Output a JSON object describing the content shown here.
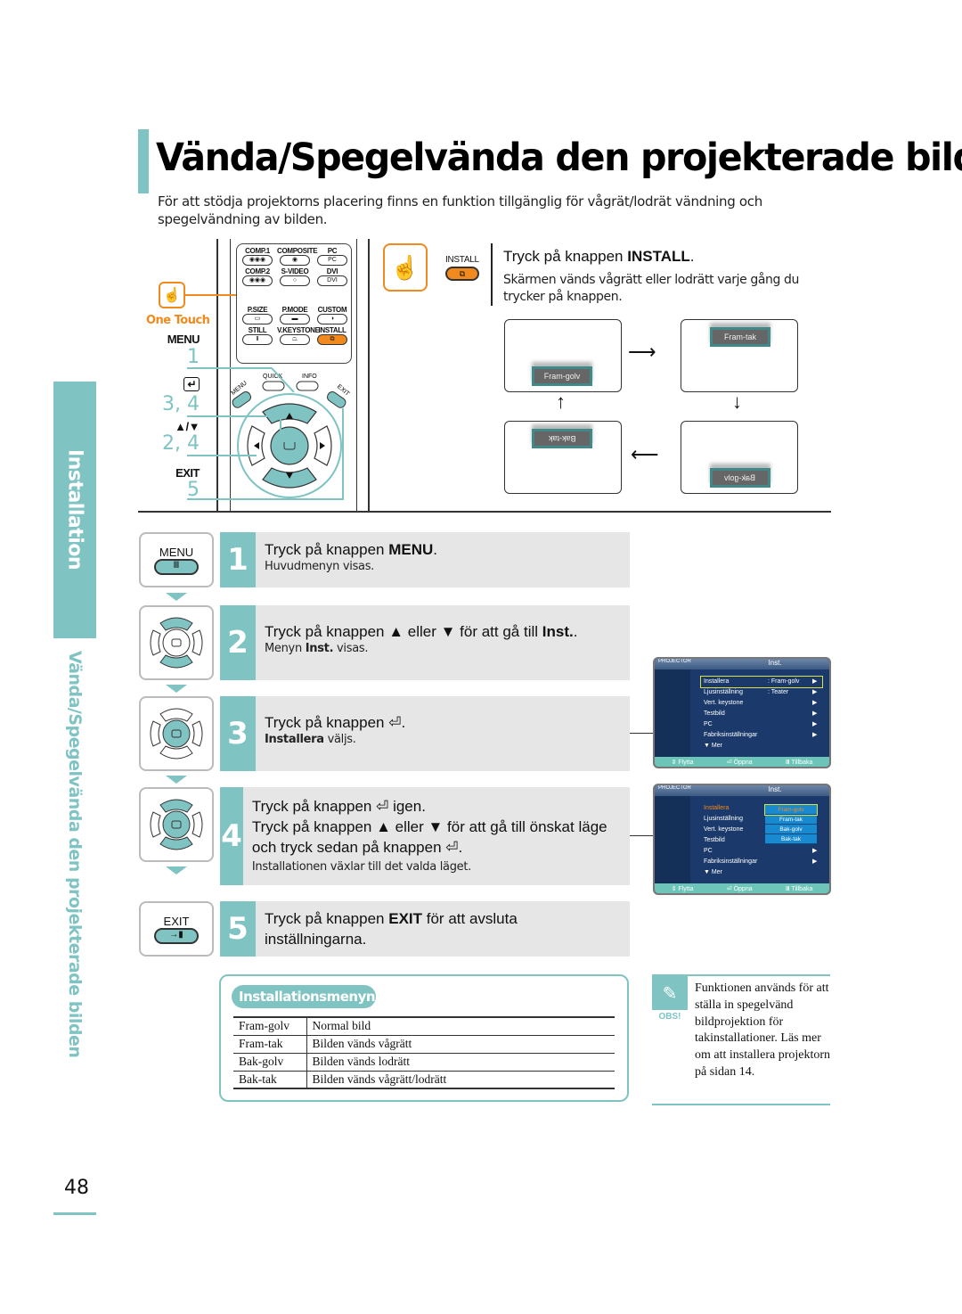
{
  "title": "Vända/Spegelvända den projekterade bilden",
  "intro": "För att stödja projektorns placering finns en funktion tillgänglig för vågrät/lodrät vändning och spegelvändning av bilden.",
  "side_tab": {
    "section": "Installation",
    "subtitle": "Vända/Spegelvända den projekterade bilden"
  },
  "remote": {
    "one_touch_label": "One Touch",
    "buttons": [
      {
        "label": "COMP.1",
        "glyph": "◉◉◉"
      },
      {
        "label": "COMPOSITE",
        "glyph": "◉"
      },
      {
        "label": "PC",
        "glyph": "PC"
      },
      {
        "label": "COMP.2",
        "glyph": "◉◉◉"
      },
      {
        "label": "S-VIDEO",
        "glyph": "○"
      },
      {
        "label": "DVI",
        "glyph": "DVI"
      },
      {
        "label": "P.SIZE",
        "glyph": "▭"
      },
      {
        "label": "P.MODE",
        "glyph": "▬"
      },
      {
        "label": "CUSTOM",
        "glyph": "◑"
      },
      {
        "label": "STILL",
        "glyph": "Ⅱ"
      },
      {
        "label": "V.KEYSTONE",
        "glyph": "⏢"
      },
      {
        "label": "INSTALL",
        "glyph": "⧉"
      }
    ],
    "nav_labels": {
      "menu": "MENU",
      "quick": "QUICK",
      "info": "INFO",
      "exit": "EXIT"
    },
    "legend": [
      {
        "key": "MENU",
        "steps": "1"
      },
      {
        "key": "↵",
        "steps": "3, 4"
      },
      {
        "key": "▲/▼",
        "steps": "2, 4"
      },
      {
        "key": "EXIT",
        "steps": "5"
      }
    ]
  },
  "install": {
    "button_label": "INSTALL",
    "heading_prefix": "Tryck på knappen ",
    "heading_bold": "INSTALL",
    "heading_suffix": ".",
    "description": "Skärmen vänds vågrätt eller lodrätt varje gång du trycker på knappen."
  },
  "flip_diagram": {
    "screens": [
      {
        "label": "Fram-golv"
      },
      {
        "label": "Fram-tak"
      },
      {
        "label": "Bak-golv"
      },
      {
        "label": "Bak-tak"
      }
    ],
    "arrows": {
      "right": "⟶",
      "down": "↓",
      "left": "⟵",
      "up": "↑"
    }
  },
  "steps": [
    {
      "num": "1",
      "button": "MENU",
      "main": [
        {
          "t": "Tryck på knappen "
        },
        {
          "t": "MENU",
          "b": true
        },
        {
          "t": "."
        }
      ],
      "sub": [
        {
          "t": "Huvudmenyn visas."
        }
      ]
    },
    {
      "num": "2",
      "main": [
        {
          "t": "Tryck på knappen ▲ eller ▼ för att gå till "
        },
        {
          "t": "Inst.",
          "b": true
        },
        {
          "t": "."
        }
      ],
      "sub": [
        {
          "t": "Menyn "
        },
        {
          "t": "Inst.",
          "b": true
        },
        {
          "t": " visas."
        }
      ]
    },
    {
      "num": "3",
      "main": [
        {
          "t": "Tryck på knappen ⏎."
        }
      ],
      "sub": [
        {
          "t": "Installera",
          "b": true
        },
        {
          "t": " väljs."
        }
      ]
    },
    {
      "num": "4",
      "main": [
        {
          "t": "Tryck på knappen ⏎ igen."
        }
      ],
      "main2": "Tryck på knappen ▲ eller ▼ för att gå till önskat läge och tryck sedan på knappen ⏎.",
      "sub": [
        {
          "t": "Installationen växlar till det valda läget."
        }
      ]
    },
    {
      "num": "5",
      "button": "EXIT",
      "main": [
        {
          "t": "Tryck på knappen "
        },
        {
          "t": "EXIT",
          "b": true
        },
        {
          "t": " för att avsluta inställningarna."
        }
      ]
    }
  ],
  "osd_menus": [
    {
      "brand": "PROJECTOR",
      "tab": "Inst.",
      "items": [
        {
          "label": "Installera",
          "value": ": Fram-golv",
          "arrow": "▶",
          "highlight": true
        },
        {
          "label": "Ljusinställning",
          "value": ": Teater",
          "arrow": "▶"
        },
        {
          "label": "Vert. keystone",
          "value": "",
          "arrow": "▶"
        },
        {
          "label": "Testbild",
          "value": "",
          "arrow": "▶"
        },
        {
          "label": "PC",
          "value": "",
          "arrow": "▶"
        },
        {
          "label": "Fabriksinställningar",
          "value": "",
          "arrow": "▶"
        },
        {
          "label": "▼ Mer",
          "value": "",
          "arrow": ""
        }
      ],
      "footer": [
        "⇕ Flytta",
        "⏎ Öppna",
        "Ⅲ Tillbaka"
      ]
    },
    {
      "brand": "PROJECTOR",
      "tab": "Inst.",
      "items": [
        {
          "label": "Installera",
          "value": ":",
          "arrow": "",
          "active": true
        },
        {
          "label": "Ljusinställning",
          "value": ":",
          "arrow": ""
        },
        {
          "label": "Vert. keystone",
          "value": "",
          "arrow": ""
        },
        {
          "label": "Testbild",
          "value": "",
          "arrow": ""
        },
        {
          "label": "PC",
          "value": "",
          "arrow": "▶"
        },
        {
          "label": "Fabriksinställningar",
          "value": "",
          "arrow": "▶"
        },
        {
          "label": "▼ Mer",
          "value": "",
          "arrow": ""
        }
      ],
      "dropdown": [
        "Fram-golv",
        "Fram-tak",
        "Bak-golv",
        "Bak-tak"
      ],
      "footer": [
        "⇕ Flytta",
        "⏎ Öppna",
        "Ⅲ Tillbaka"
      ]
    }
  ],
  "install_menu_table": {
    "title": "Installationsmenyn",
    "rows": [
      {
        "key": "Fram-golv",
        "desc": "Normal bild"
      },
      {
        "key": "Fram-tak",
        "desc": "Bilden vänds vågrätt"
      },
      {
        "key": "Bak-golv",
        "desc": "Bilden vänds lodrätt"
      },
      {
        "key": "Bak-tak",
        "desc": "Bilden vänds vågrätt/lodrätt"
      }
    ]
  },
  "note": {
    "label": "OBS!",
    "text": "Funktionen används för att ställa in spegelvänd bildprojektion för takinstallationer. Läs mer om att installera projektorn på sidan 14."
  },
  "page_number": "48",
  "colors": {
    "accent": "#7fc3c3",
    "orange": "#f08a1e",
    "step_bg": "#e6e6e6",
    "osd_bg": "#1b3a6b"
  }
}
